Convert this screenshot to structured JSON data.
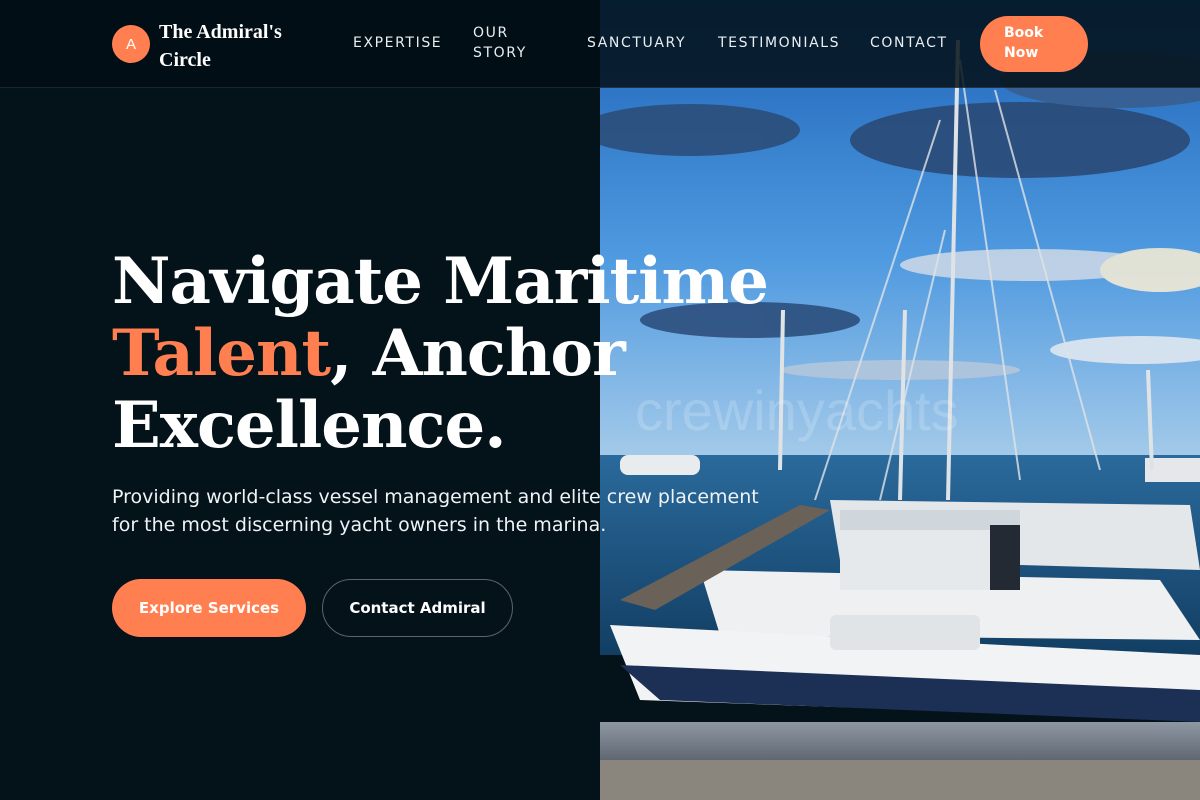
{
  "brand": {
    "mark": "A",
    "name": "The Admiral's Circle"
  },
  "nav": {
    "links": [
      "EXPERTISE",
      "OUR STORY",
      "SANCTUARY",
      "TESTIMONIALS",
      "CONTACT"
    ],
    "cta": "Book Now"
  },
  "hero": {
    "headline_line1": "Navigate Maritime",
    "headline_accent": "Talent",
    "headline_line2_rest": ", Anchor",
    "headline_line3": "Excellence.",
    "subtext": "Providing world-class vessel management and elite crew placement for the most discerning yacht owners in the marina.",
    "primary_button": "Explore Services",
    "secondary_button": "Contact Admiral",
    "watermark": "crewinyachts"
  },
  "colors": {
    "accent": "#ff7f50",
    "background": "#04121a",
    "text": "#ffffff"
  },
  "icons": {
    "brand_mark": "circle-letter-logo-icon"
  }
}
